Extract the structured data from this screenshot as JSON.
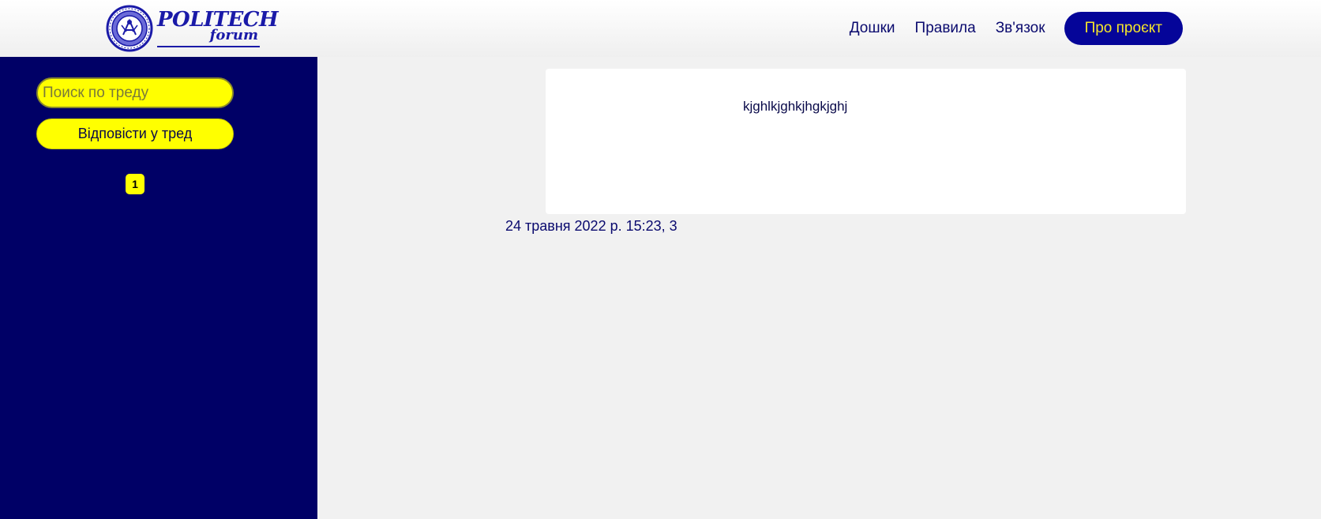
{
  "logo": {
    "word1": "POLITECH",
    "word2": "forum"
  },
  "nav": {
    "items": [
      "Дошки",
      "Правила",
      "Зв'язок"
    ],
    "cta": "Про проєкт"
  },
  "sidebar": {
    "search_placeholder": "Поиск по треду",
    "reply_label": "Відповісти у тред",
    "pages": [
      "1"
    ]
  },
  "post": {
    "text": "kjghlkjghkjhgkjghj",
    "meta": "24 травня 2022 р. 15:23, 3"
  },
  "colors": {
    "sidebar_bg": "#000066",
    "accent_yellow": "#ffff00",
    "cta_bg": "#050599",
    "cta_text": "#f6e72a",
    "text_navy": "#0a0a6e"
  }
}
